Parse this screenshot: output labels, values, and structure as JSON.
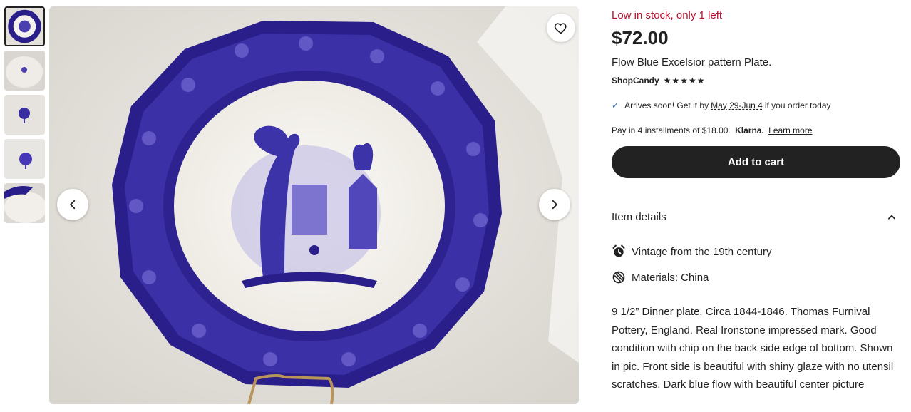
{
  "stock_notice": "Low in stock, only 1 left",
  "price": "$72.00",
  "title": "Flow Blue Excelsior pattern Plate.",
  "shop": {
    "name": "ShopCandy",
    "rating_stars": 5
  },
  "shipping": {
    "prefix": "Arrives soon! Get it by",
    "dates": "May 29-Jun 4",
    "suffix": "if you order today"
  },
  "installments": {
    "text": "Pay in 4 installments of $18.00.",
    "provider": "Klarna.",
    "link": "Learn more"
  },
  "add_to_cart": "Add to cart",
  "item_details": {
    "label": "Item details",
    "rows": [
      {
        "icon": "alarm-clock-icon",
        "text": "Vintage from the 19th century"
      },
      {
        "icon": "materials-icon",
        "text": "Materials: China"
      }
    ],
    "description": "9 1/2” Dinner plate. Circa 1844-1846. Thomas Furnival Pottery, England. Real Ironstone impressed mark. Good condition with chip on the back side edge of bottom. Shown in pic. Front side is beautiful with shiny glaze with no utensil scratches. Dark blue flow with beautiful center picture"
  },
  "colors": {
    "stock_red": "#b3112e",
    "button_dark": "#222222",
    "flow_blue": "#2a1f8a"
  },
  "icons": {
    "prev": "chevron-left-icon",
    "next": "chevron-right-icon",
    "favorite": "heart-icon",
    "check": "checkmark-icon"
  }
}
